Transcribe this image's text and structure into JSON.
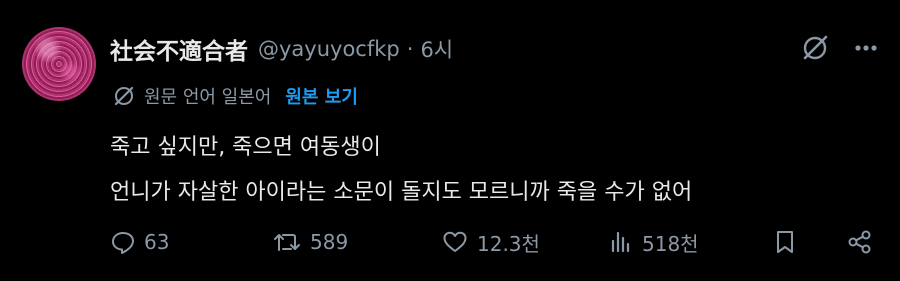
{
  "tweet": {
    "display_name": "社会不適合者",
    "handle": "@yayuyocfkp",
    "separator": "·",
    "time": "6시",
    "translation": {
      "note": "원문 언어 일본어",
      "show_original": "원본 보기"
    },
    "body_lines": [
      "죽고 싶지만, 죽으면 여동생이",
      "언니가 자살한 아이라는 소문이 돌지도 모르니까 죽을 수가 없어"
    ],
    "actions": {
      "replies": "63",
      "retweets": "589",
      "likes": "12.3천",
      "views": "518천"
    },
    "icons": {
      "grok": "grok-icon",
      "more": "more-icon",
      "translate": "translate-icon",
      "reply": "reply-icon",
      "retweet": "retweet-icon",
      "like": "heart-icon",
      "views": "views-icon",
      "bookmark": "bookmark-icon",
      "share": "share-icon"
    },
    "colors": {
      "background": "#000000",
      "text": "#e7e9ea",
      "secondary": "#8b98a5",
      "link": "#1d9bf0"
    }
  }
}
